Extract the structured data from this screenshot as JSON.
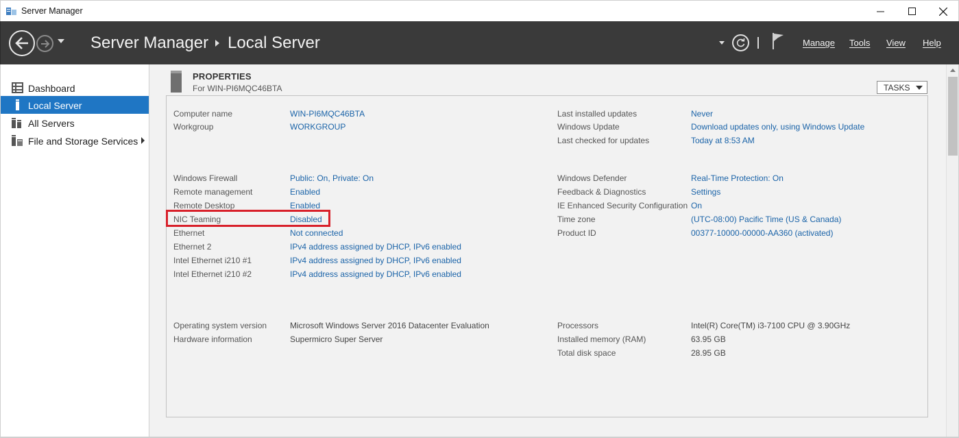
{
  "window": {
    "title": "Server Manager"
  },
  "header": {
    "app_name": "Server Manager",
    "current_page": "Local Server",
    "menus": {
      "manage": "Manage",
      "tools": "Tools",
      "view": "View",
      "help": "Help"
    }
  },
  "sidebar": {
    "items": [
      {
        "label": "Dashboard",
        "icon": "dashboard-icon"
      },
      {
        "label": "Local Server",
        "icon": "server-icon",
        "active": true
      },
      {
        "label": "All Servers",
        "icon": "servers-icon"
      },
      {
        "label": "File and Storage Services",
        "icon": "storage-icon"
      }
    ]
  },
  "properties": {
    "title": "PROPERTIES",
    "subtitle": "For WIN-PI6MQC46BTA",
    "tasks_label": "TASKS",
    "left": [
      {
        "label": "Computer name",
        "value": "WIN-PI6MQC46BTA",
        "link": true
      },
      {
        "label": "Workgroup",
        "value": "WORKGROUP",
        "link": true
      },
      {
        "label": "Windows Firewall",
        "value": "Public: On, Private: On",
        "link": true
      },
      {
        "label": "Remote management",
        "value": "Enabled",
        "link": true
      },
      {
        "label": "Remote Desktop",
        "value": "Enabled",
        "link": true
      },
      {
        "label": "NIC Teaming",
        "value": "Disabled",
        "link": true
      },
      {
        "label": "Ethernet",
        "value": "Not connected",
        "link": true
      },
      {
        "label": "Ethernet 2",
        "value": "IPv4 address assigned by DHCP, IPv6 enabled",
        "link": true
      },
      {
        "label": "Intel Ethernet i210 #1",
        "value": "IPv4 address assigned by DHCP, IPv6 enabled",
        "link": true
      },
      {
        "label": "Intel Ethernet i210 #2",
        "value": "IPv4 address assigned by DHCP, IPv6 enabled",
        "link": true
      },
      {
        "label": "Operating system version",
        "value": "Microsoft Windows Server 2016 Datacenter Evaluation",
        "link": false
      },
      {
        "label": "Hardware information",
        "value": "Supermicro Super Server",
        "link": false
      }
    ],
    "right": [
      {
        "label": "Last installed updates",
        "value": "Never",
        "link": true
      },
      {
        "label": "Windows Update",
        "value": "Download updates only, using Windows Update",
        "link": true
      },
      {
        "label": "Last checked for updates",
        "value": "Today at 8:53 AM",
        "link": true
      },
      {
        "label": "Windows Defender",
        "value": "Real-Time Protection: On",
        "link": true
      },
      {
        "label": "Feedback & Diagnostics",
        "value": "Settings",
        "link": true
      },
      {
        "label": "IE Enhanced Security Configuration",
        "value": "On",
        "link": true
      },
      {
        "label": "Time zone",
        "value": "(UTC-08:00) Pacific Time (US & Canada)",
        "link": true
      },
      {
        "label": "Product ID",
        "value": "00377-10000-00000-AA360 (activated)",
        "link": true
      },
      {
        "label": "Processors",
        "value": "Intel(R) Core(TM) i3-7100 CPU @ 3.90GHz",
        "link": false
      },
      {
        "label": "Installed memory (RAM)",
        "value": "63.95 GB",
        "link": false
      },
      {
        "label": "Total disk space",
        "value": "28.95 GB",
        "link": false
      }
    ]
  },
  "colors": {
    "header_bg": "#3a3a3a",
    "active_nav": "#1f76c4",
    "link": "#1a63a8",
    "highlight": "#d8202a"
  }
}
